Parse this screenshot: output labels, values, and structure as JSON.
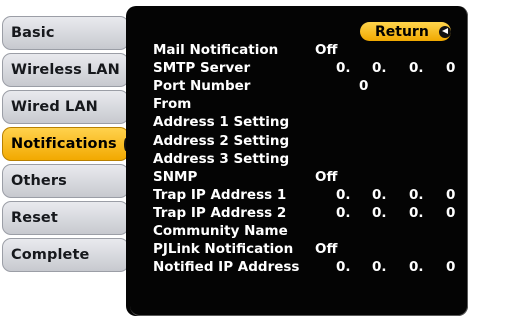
{
  "menu": {
    "items": [
      {
        "label": "Basic"
      },
      {
        "label": "Wireless LAN"
      },
      {
        "label": "Wired LAN"
      },
      {
        "label": "Notifications"
      },
      {
        "label": "Others"
      },
      {
        "label": "Reset"
      },
      {
        "label": "Complete"
      }
    ]
  },
  "panel": {
    "return_label": "Return",
    "rows": [
      {
        "label": "Mail Notification",
        "value": "Off"
      },
      {
        "label": "SMTP Server",
        "ip": [
          "0.",
          "0.",
          "0.",
          "0"
        ]
      },
      {
        "label": "Port Number",
        "value": "0"
      },
      {
        "label": "From",
        "value": ""
      },
      {
        "label": "Address 1 Setting",
        "value": ""
      },
      {
        "label": "Address 2 Setting",
        "value": ""
      },
      {
        "label": "Address 3 Setting",
        "value": ""
      },
      {
        "label": "SNMP",
        "value": "Off"
      },
      {
        "label": "Trap IP Address 1",
        "ip": [
          "0.",
          "0.",
          "0.",
          "0"
        ]
      },
      {
        "label": "Trap IP Address 2",
        "ip": [
          "0.",
          "0.",
          "0.",
          "0"
        ]
      },
      {
        "label": "Community Name",
        "value": ""
      },
      {
        "label": "PJLink Notification",
        "value": "Off"
      },
      {
        "label": "Notified IP Address",
        "ip": [
          "0.",
          "0.",
          "0.",
          "0"
        ]
      }
    ]
  }
}
